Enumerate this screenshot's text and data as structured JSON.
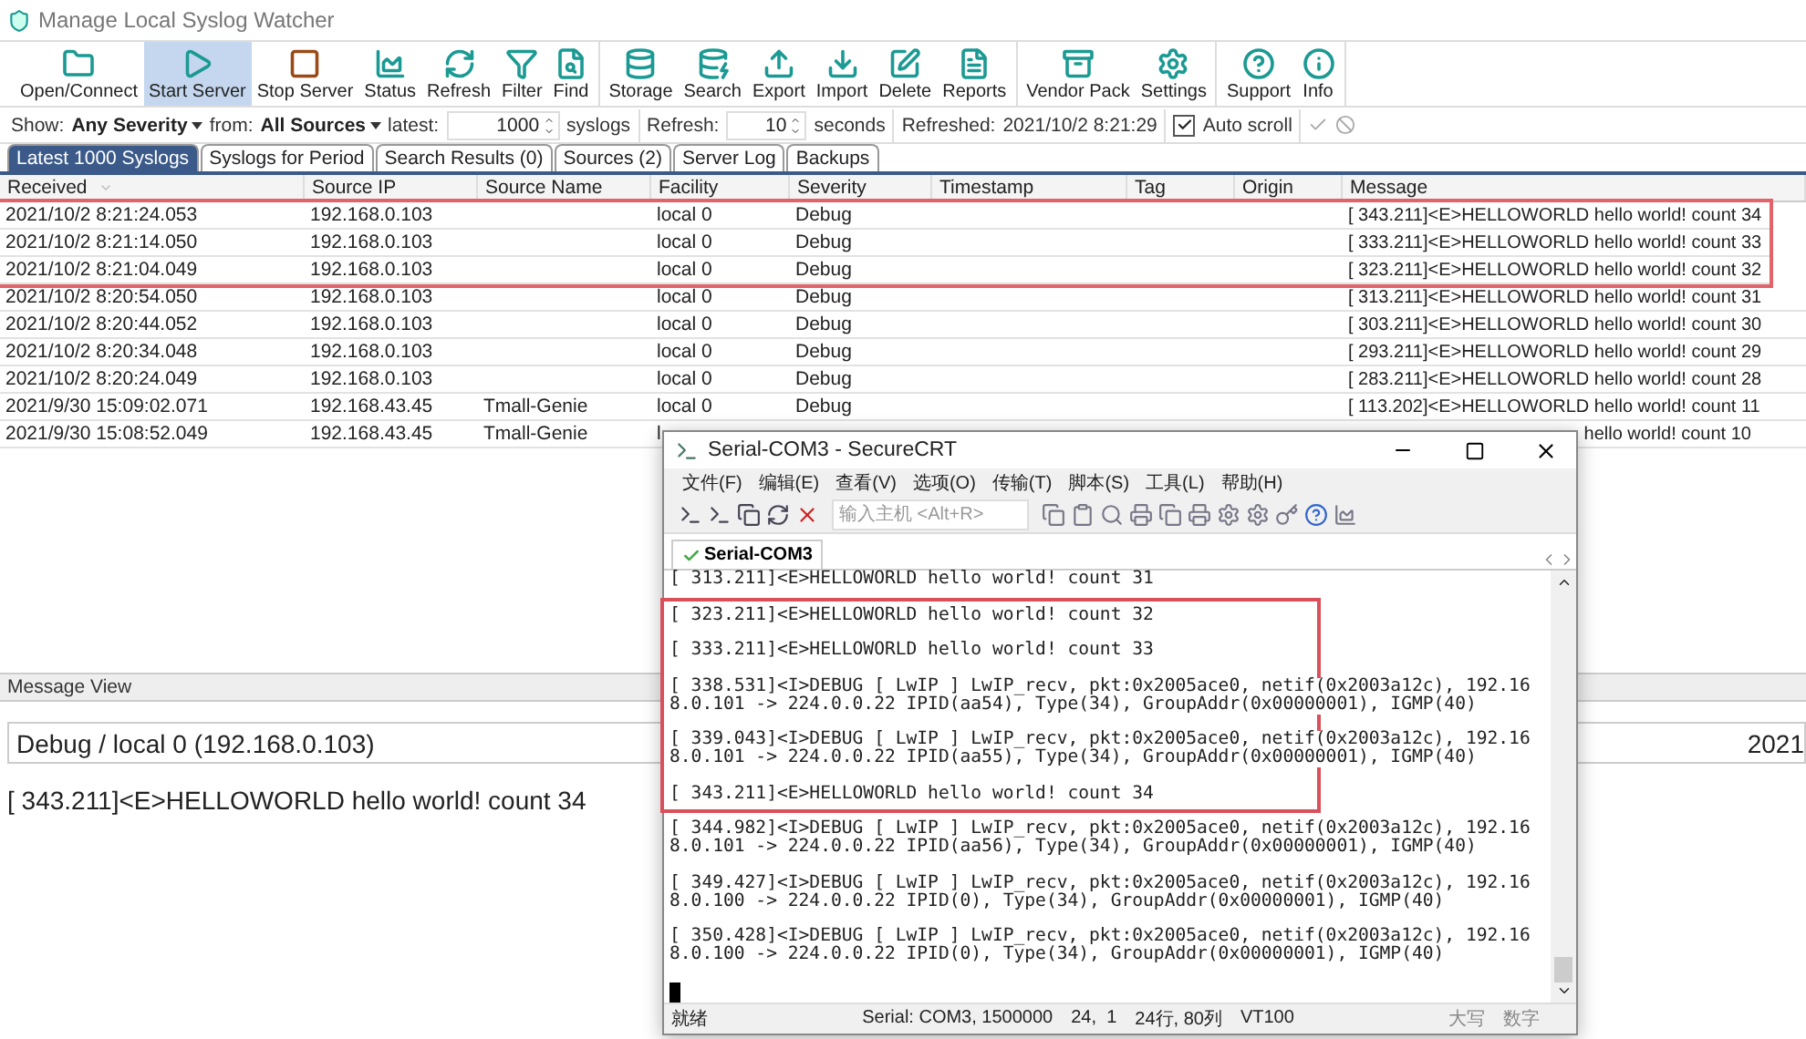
{
  "window": {
    "title": "Manage Local Syslog Watcher"
  },
  "toolbar": {
    "groups": [
      [
        {
          "label": "Open/Connect",
          "selected": false
        },
        {
          "label": "Start Server",
          "selected": true
        },
        {
          "label": "Stop Server",
          "selected": false
        },
        {
          "label": "Status",
          "selected": false
        },
        {
          "label": "Refresh",
          "selected": false
        },
        {
          "label": "Filter",
          "selected": false
        },
        {
          "label": "Find",
          "selected": false
        }
      ],
      [
        {
          "label": "Storage",
          "selected": false
        },
        {
          "label": "Search",
          "selected": false
        },
        {
          "label": "Export",
          "selected": false
        },
        {
          "label": "Import",
          "selected": false
        },
        {
          "label": "Delete",
          "selected": false
        },
        {
          "label": "Reports",
          "selected": false
        }
      ],
      [
        {
          "label": "Vendor Pack",
          "selected": false
        },
        {
          "label": "Settings",
          "selected": false
        }
      ],
      [
        {
          "label": "Support",
          "selected": false
        },
        {
          "label": "Info",
          "selected": false
        }
      ]
    ]
  },
  "filter_bar": {
    "show_label": "Show:",
    "severity": "Any Severity",
    "from_label": "from:",
    "sources": "All Sources",
    "latest_label": "latest:",
    "latest_value": "1000",
    "latest_unit": "syslogs",
    "refresh_label": "Refresh:",
    "refresh_value": "10",
    "refresh_unit": "seconds",
    "refreshed_label": "Refreshed:",
    "refreshed_value": "2021/10/2 8:21:29",
    "auto_scroll": {
      "label": "Auto scroll",
      "checked": true
    }
  },
  "tabs": [
    {
      "label": "Latest 1000 Syslogs",
      "selected": true
    },
    {
      "label": "Syslogs for Period",
      "selected": false
    },
    {
      "label": "Search Results (0)",
      "selected": false
    },
    {
      "label": "Sources (2)",
      "selected": false
    },
    {
      "label": "Server Log",
      "selected": false
    },
    {
      "label": "Backups",
      "selected": false
    }
  ],
  "table": {
    "columns": [
      "Received",
      "Source IP",
      "Source Name",
      "Facility",
      "Severity",
      "Timestamp",
      "Tag",
      "Origin",
      "Message"
    ],
    "rows": [
      {
        "cells": [
          "2021/10/2 8:21:24.053",
          "192.168.0.103",
          "",
          "local 0",
          "Debug",
          "",
          "",
          "",
          "[ 343.211]<E>HELLOWORLD hello world! count 34"
        ],
        "highlighted": true
      },
      {
        "cells": [
          "2021/10/2 8:21:14.050",
          "192.168.0.103",
          "",
          "local 0",
          "Debug",
          "",
          "",
          "",
          "[ 333.211]<E>HELLOWORLD hello world! count 33"
        ],
        "highlighted": true
      },
      {
        "cells": [
          "2021/10/2 8:21:04.049",
          "192.168.0.103",
          "",
          "local 0",
          "Debug",
          "",
          "",
          "",
          "[ 323.211]<E>HELLOWORLD hello world! count 32"
        ],
        "highlighted": true
      },
      {
        "cells": [
          "2021/10/2 8:20:54.050",
          "192.168.0.103",
          "",
          "local 0",
          "Debug",
          "",
          "",
          "",
          "[ 313.211]<E>HELLOWORLD hello world! count 31"
        ],
        "highlighted": false
      },
      {
        "cells": [
          "2021/10/2 8:20:44.052",
          "192.168.0.103",
          "",
          "local 0",
          "Debug",
          "",
          "",
          "",
          "[ 303.211]<E>HELLOWORLD hello world! count 30"
        ],
        "highlighted": false
      },
      {
        "cells": [
          "2021/10/2 8:20:34.048",
          "192.168.0.103",
          "",
          "local 0",
          "Debug",
          "",
          "",
          "",
          "[ 293.211]<E>HELLOWORLD hello world! count 29"
        ],
        "highlighted": false
      },
      {
        "cells": [
          "2021/10/2 8:20:24.049",
          "192.168.0.103",
          "",
          "local 0",
          "Debug",
          "",
          "",
          "",
          "[ 283.211]<E>HELLOWORLD hello world! count 28"
        ],
        "highlighted": false
      },
      {
        "cells": [
          "2021/9/30 15:09:02.071",
          "192.168.43.45",
          "Tmall-Genie",
          "local 0",
          "Debug",
          "",
          "",
          "",
          "[ 113.202]<E>HELLOWORLD hello world! count 11"
        ],
        "highlighted": false
      },
      {
        "cells": [
          "2021/9/30 15:08:52.049",
          "192.168.43.45",
          "Tmall-Genie",
          "l",
          "",
          "",
          "",
          "",
          "hello world! count 10"
        ],
        "highlighted": false
      }
    ]
  },
  "message_view": {
    "title": "Message View",
    "severity_facility": "Debug / local 0",
    "source": "(192.168.0.103)",
    "time": "2021",
    "message": "[ 343.211]<E>HELLOWORLD hello world! count 34"
  },
  "terminal_window": {
    "title": "Serial-COM3 - SecureCRT",
    "menu": [
      "文件(F)",
      "编辑(E)",
      "查看(V)",
      "选项(O)",
      "传输(T)",
      "脚本(S)",
      "工具(L)",
      "帮助(H)"
    ],
    "host_field": {
      "placeholder": "输入主机 <Alt+R>"
    },
    "session_tab": {
      "label": "Serial-COM3",
      "selected": true
    },
    "entries": [
      {
        "lines": [
          "[ 313.211]<E>HELLOWORLD hello world! count 31"
        ],
        "highlighted": false
      },
      {
        "lines": [
          "[ 323.211]<E>HELLOWORLD hello world! count 32"
        ],
        "highlighted": true
      },
      {
        "lines": [
          "[ 333.211]<E>HELLOWORLD hello world! count 33"
        ],
        "highlighted": true
      },
      {
        "lines": [
          "[ 338.531]<I>DEBUG [ LwIP ] LwIP_recv, pkt:0x2005ace0, netif(0x2003a12c), 192.16",
          "8.0.101 -> 224.0.0.22 IPID(aa54), Type(34), GroupAddr(0x00000001), IGMP(40)"
        ],
        "highlighted": true
      },
      {
        "lines": [
          "[ 339.043]<I>DEBUG [ LwIP ] LwIP_recv, pkt:0x2005ace0, netif(0x2003a12c), 192.16",
          "8.0.101 -> 224.0.0.22 IPID(aa55), Type(34), GroupAddr(0x00000001), IGMP(40)"
        ],
        "highlighted": true
      },
      {
        "lines": [
          "[ 343.211]<E>HELLOWORLD hello world! count 34"
        ],
        "highlighted": true
      },
      {
        "lines": [
          "[ 344.982]<I>DEBUG [ LwIP ] LwIP_recv, pkt:0x2005ace0, netif(0x2003a12c), 192.16",
          "8.0.101 -> 224.0.0.22 IPID(aa56), Type(34), GroupAddr(0x00000001), IGMP(40)"
        ],
        "highlighted": false
      },
      {
        "lines": [
          "[ 349.427]<I>DEBUG [ LwIP ] LwIP_recv, pkt:0x2005ace0, netif(0x2003a12c), 192.16",
          "8.0.100 -> 224.0.0.22 IPID(0), Type(34), GroupAddr(0x00000001), IGMP(40)"
        ],
        "highlighted": false
      },
      {
        "lines": [
          "[ 350.428]<I>DEBUG [ LwIP ] LwIP_recv, pkt:0x2005ace0, netif(0x2003a12c), 192.16",
          "8.0.100 -> 224.0.0.22 IPID(0), Type(34), GroupAddr(0x00000001), IGMP(40)"
        ],
        "highlighted": false
      }
    ],
    "status_bar": [
      "就绪",
      "Serial: COM3, 1500000",
      "24,  1",
      "24行, 80列",
      "VT100",
      "大写",
      "数字"
    ]
  }
}
